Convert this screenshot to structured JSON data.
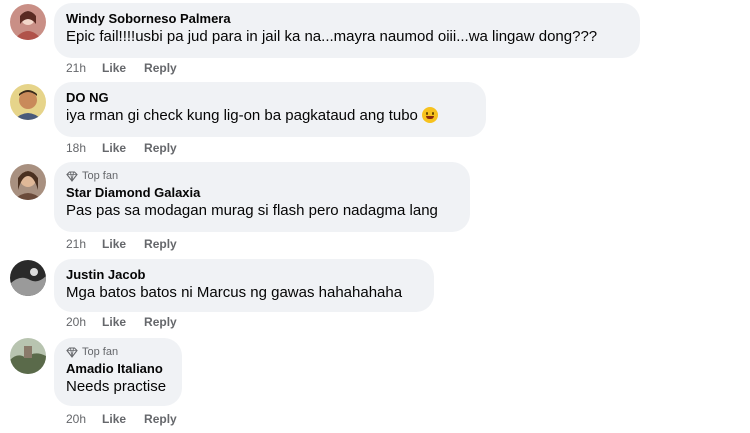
{
  "comments": [
    {
      "author": "Windy Soborneso Palmera",
      "badge": "",
      "text": "Epic fail!!!!usbi pa jud para in jail ka na...mayra naumod oiii...wa lingaw dong???",
      "time": "21h",
      "like": "Like",
      "reply": "Reply",
      "avatar_color": "#b9726a"
    },
    {
      "author": "DO NG",
      "badge": "",
      "text": "iya rman gi check kung lig-on ba pagkataud ang tubo",
      "emoji": "grinning-face",
      "time": "18h",
      "like": "Like",
      "reply": "Reply",
      "avatar_color": "#d9c27a"
    },
    {
      "author": "Star Diamond Galaxia",
      "badge": "Top fan",
      "text": "Pas pas sa modagan murag si flash pero nadagma lang",
      "time": "21h",
      "like": "Like",
      "reply": "Reply",
      "avatar_color": "#8a6a5a"
    },
    {
      "author": "Justin Jacob",
      "badge": "",
      "text": "Mga batos batos ni Marcus ng gawas hahahahaha",
      "time": "20h",
      "like": "Like",
      "reply": "Reply",
      "avatar_color": "#3c3c3c"
    },
    {
      "author": "Amadio Italiano",
      "badge": "Top fan",
      "text": "Needs practise",
      "time": "20h",
      "like": "Like",
      "reply": "Reply",
      "avatar_color": "#7d8a6a"
    }
  ],
  "colors": {
    "bubble": "#f0f2f5",
    "meta": "#65676b",
    "text": "#050505"
  }
}
